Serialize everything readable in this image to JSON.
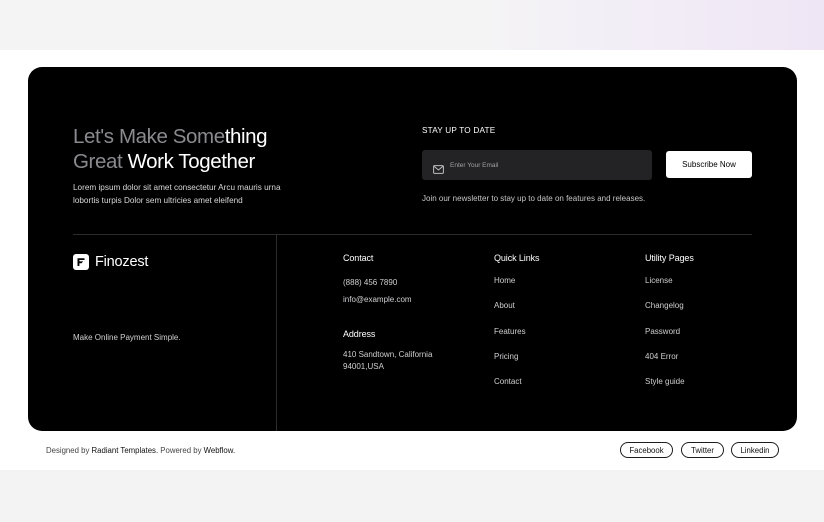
{
  "headline": {
    "line1_dim": "Let's Make Some",
    "line1_bright": "thing",
    "line2_dim": "Great ",
    "line2_bright": "Work Together"
  },
  "intro_text": "Lorem ipsum dolor sit amet consectetur Arcu mauris urna lobortis turpis Dolor sem ultricies amet eleifend",
  "newsletter": {
    "title": "STAY UP TO DATE",
    "placeholder": "Enter Your Email",
    "button_label": "Subscribe Now",
    "note": "Join our newsletter to stay up to date on features and releases."
  },
  "brand": {
    "name": "Finozest",
    "tagline": "Make Online Payment Simple."
  },
  "contact": {
    "title": "Contact",
    "phone": "(888) 456 7890",
    "email": "info@example.com",
    "address_title": "Address",
    "address_line1": "410 Sandtown, California",
    "address_line2": "94001,USA"
  },
  "quick_links": {
    "title": "Quick Links",
    "items": [
      "Home",
      "About",
      "Features",
      "Pricing",
      "Contact"
    ]
  },
  "utility_pages": {
    "title": "Utility Pages",
    "items": [
      "License",
      "Changelog",
      "Password",
      "404 Error",
      "Style guide"
    ]
  },
  "bottom_bar": {
    "designed_by": "Designed by ",
    "radiant": "Radiant Templates.",
    "powered_by": " Powered by ",
    "webflow": "Webflow.",
    "social": [
      "Facebook",
      "Twitter",
      "Linkedin"
    ]
  },
  "colors": {
    "card_bg": "#000000",
    "accent_text": "#ffffff",
    "muted_text": "#8a8a8f",
    "input_bg": "#232325"
  },
  "icons": [
    "mail-icon",
    "finozest-logo-icon"
  ]
}
